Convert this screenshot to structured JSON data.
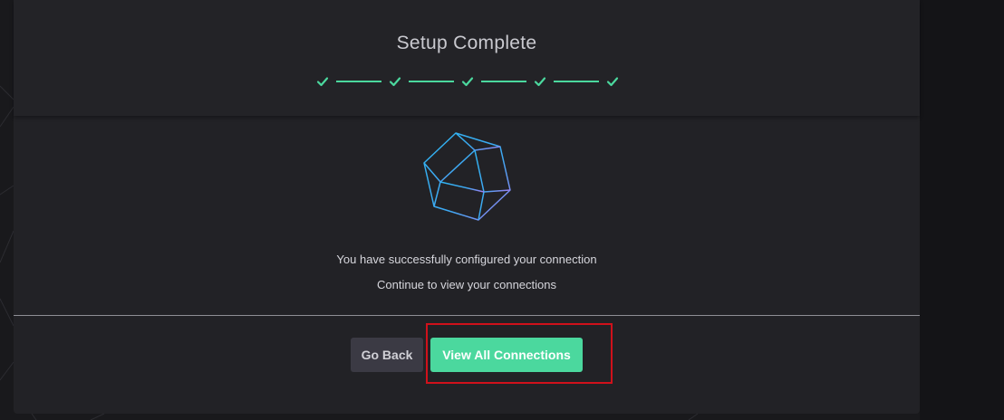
{
  "dialog": {
    "title": "Setup Complete",
    "steps": [
      {
        "icon": "check-icon",
        "completed": true
      },
      {
        "icon": "check-icon",
        "completed": true
      },
      {
        "icon": "check-icon",
        "completed": true
      },
      {
        "icon": "check-icon",
        "completed": true
      },
      {
        "icon": "check-icon",
        "completed": true
      }
    ],
    "logo_icon": "hexagon-gem-icon",
    "message_primary": "You have successfully configured your connection",
    "message_secondary": "Continue to view your connections"
  },
  "actions": {
    "back_label": "Go Back",
    "view_all_label": "View All Connections"
  },
  "colors": {
    "accent": "#4bd89e",
    "highlight_box": "#d0111b",
    "panel": "#222226"
  }
}
